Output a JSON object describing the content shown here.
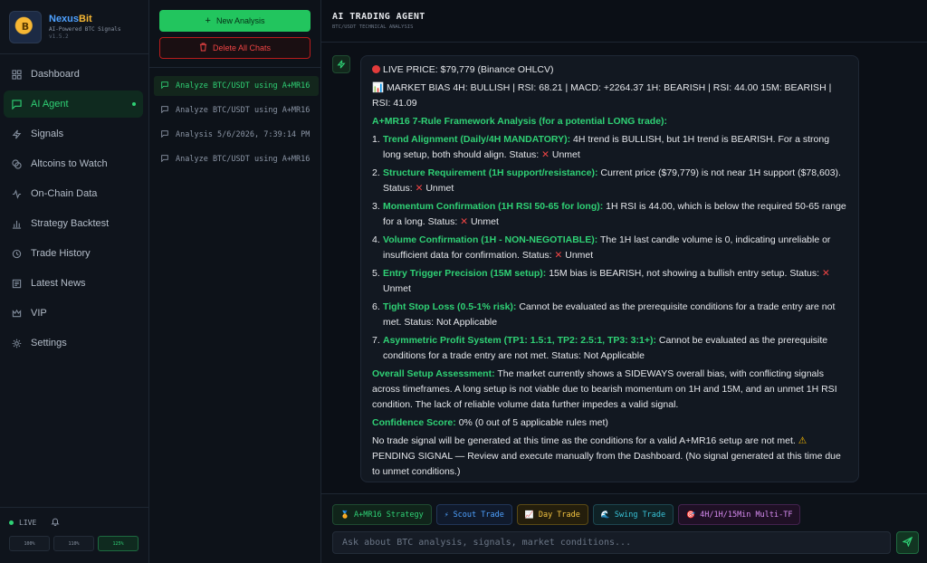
{
  "brand": {
    "name_part1": "Nexus",
    "name_part2": "Bit",
    "subtitle": "AI-Powered BTC Signals",
    "version": "v1.5.2",
    "logo_letter": "B"
  },
  "nav": {
    "items": [
      {
        "label": "Dashboard",
        "icon": "grid-icon"
      },
      {
        "label": "AI Agent",
        "icon": "message-square-icon",
        "active": true
      },
      {
        "label": "Signals",
        "icon": "lightning-icon"
      },
      {
        "label": "Altcoins to Watch",
        "icon": "coins-icon"
      },
      {
        "label": "On-Chain Data",
        "icon": "activity-icon"
      },
      {
        "label": "Strategy Backtest",
        "icon": "bar-chart-icon"
      },
      {
        "label": "Trade History",
        "icon": "history-icon"
      },
      {
        "label": "Latest News",
        "icon": "newspaper-icon"
      },
      {
        "label": "VIP",
        "icon": "crown-icon"
      },
      {
        "label": "Settings",
        "icon": "gear-icon"
      }
    ]
  },
  "footer": {
    "live_label": "LIVE",
    "zoom_options": [
      "100%",
      "110%",
      "125%"
    ],
    "zoom_selected": "125%"
  },
  "chats": {
    "new_label": "New Analysis",
    "delete_label": "Delete All Chats",
    "items": [
      "Analyze BTC/USDT using A+MR16",
      "Analyze BTC/USDT using A+MR16",
      "Analysis 5/6/2026, 7:39:14 PM",
      "Analyze BTC/USDT using A+MR16"
    ]
  },
  "header": {
    "title": "AI TRADING AGENT",
    "subtitle": "BTC/USDT TECHNICAL ANALYSIS"
  },
  "message": {
    "price_line": "LIVE PRICE: $79,779 (Binance OHLCV)",
    "bias_line": "MARKET BIAS 4H: BULLISH | RSI: 68.21 | MACD: +2264.37 1H: BEARISH | RSI: 44.00 15M: BEARISH | RSI: 41.09",
    "framework_heading": "A+MR16 7-Rule Framework Analysis (for a potential LONG trade):",
    "rules": [
      {
        "num": "1.",
        "title": "Trend Alignment (Daily/4H MANDATORY):",
        "text": " 4H trend is BULLISH, but 1H trend is BEARISH. For a strong long setup, both should align. Status: ",
        "status": "Unmet",
        "cross": true
      },
      {
        "num": "2.",
        "title": "Structure Requirement (1H support/resistance):",
        "text": " Current price ($79,779) is not near 1H support ($78,603). Status: ",
        "status": "Unmet",
        "cross": true
      },
      {
        "num": "3.",
        "title": "Momentum Confirmation (1H RSI 50-65 for long):",
        "text": " 1H RSI is 44.00, which is below the required 50-65 range for a long. Status: ",
        "status": "Unmet",
        "cross": true
      },
      {
        "num": "4.",
        "title": "Volume Confirmation (1H - NON-NEGOTIABLE):",
        "text": " The 1H last candle volume is 0, indicating unreliable or insufficient data for confirmation. Status: ",
        "status": "Unmet",
        "cross": true
      },
      {
        "num": "5.",
        "title": "Entry Trigger Precision (15M setup):",
        "text": " 15M bias is BEARISH, not showing a bullish entry setup. Status: ",
        "status": "Unmet",
        "cross": true
      },
      {
        "num": "6.",
        "title": "Tight Stop Loss (0.5-1% risk):",
        "text": " Cannot be evaluated as the prerequisite conditions for a trade entry are not met. Status: ",
        "status": "Not Applicable",
        "cross": false
      },
      {
        "num": "7.",
        "title": "Asymmetric Profit System (TP1: 1.5:1, TP2: 2.5:1, TP3: 3:1+):",
        "text": " Cannot be evaluated as the prerequisite conditions for a trade entry are not met. Status: ",
        "status": "Not Applicable",
        "cross": false
      }
    ],
    "overall_title": "Overall Setup Assessment:",
    "overall_text": " The market currently shows a SIDEWAYS overall bias, with conflicting signals across timeframes. A long setup is not viable due to bearish momentum on 1H and 15M, and an unmet 1H RSI condition. The lack of reliable volume data further impedes a valid signal.",
    "confidence_title": "Confidence Score:",
    "confidence_text": " 0% (0 out of 5 applicable rules met)",
    "closing_text_1": "No trade signal will be generated at this time as the conditions for a valid A+MR16 setup are not met. ",
    "closing_text_2": " PENDING SIGNAL — Review and execute manually from the Dashboard. (No signal generated at this time due to unmet conditions.)"
  },
  "composer": {
    "chips": [
      {
        "label": "A+MR16 Strategy",
        "icon": "🏅"
      },
      {
        "label": "Scout Trade",
        "icon": "⚡"
      },
      {
        "label": "Day Trade",
        "icon": "📈"
      },
      {
        "label": "Swing Trade",
        "icon": "🌊"
      },
      {
        "label": "4H/1H/15Min Multi-TF",
        "icon": "🎯"
      }
    ],
    "placeholder": "Ask about BTC analysis, signals, market conditions..."
  },
  "colors": {
    "accent": "#22c55e",
    "danger": "#ef4444",
    "background": "#0b0f16"
  }
}
